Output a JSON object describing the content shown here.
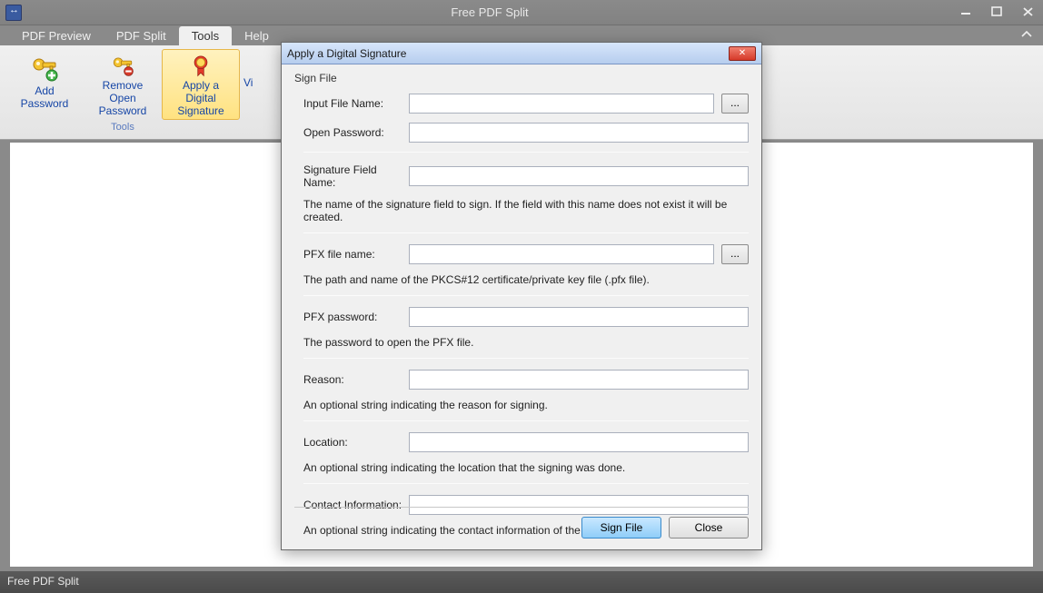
{
  "app": {
    "title": "Free PDF Split"
  },
  "menu": {
    "tabs": [
      {
        "label": "PDF Preview"
      },
      {
        "label": "PDF Split"
      },
      {
        "label": "Tools"
      },
      {
        "label": "Help"
      }
    ]
  },
  "ribbon": {
    "group_label": "Tools",
    "partial_btn": "Vi",
    "items": [
      {
        "label_line1": "Add",
        "label_line2": "Password"
      },
      {
        "label_line1": "Remove Open",
        "label_line2": "Password"
      },
      {
        "label_line1": "Apply a Digital",
        "label_line2": "Signature"
      }
    ]
  },
  "dialog": {
    "title": "Apply a Digital Signature",
    "group": "Sign File",
    "browse": "...",
    "fields": {
      "input_file": {
        "label": "Input File Name:",
        "value": ""
      },
      "open_password": {
        "label": "Open Password:",
        "value": ""
      },
      "sig_field": {
        "label": "Signature Field Name:",
        "value": "",
        "hint": "The name of the signature field to sign. If the field with this name does not exist it will be created."
      },
      "pfx_file": {
        "label": "PFX file name:",
        "value": "",
        "hint": "The path and name of the PKCS#12 certificate/private key file (.pfx file)."
      },
      "pfx_password": {
        "label": "PFX password:",
        "value": "",
        "hint": "The password to open the PFX file."
      },
      "reason": {
        "label": "Reason:",
        "value": "",
        "hint": "An optional string indicating the reason for signing."
      },
      "location": {
        "label": "Location:",
        "value": "",
        "hint": "An optional string indicating the location that the signing was done."
      },
      "contact": {
        "label": "Contact Information:",
        "value": "",
        "hint": "An optional string indicating the contact information of the signer."
      }
    },
    "buttons": {
      "primary": "Sign File",
      "secondary": "Close"
    }
  },
  "status": {
    "text": "Free PDF Split"
  }
}
